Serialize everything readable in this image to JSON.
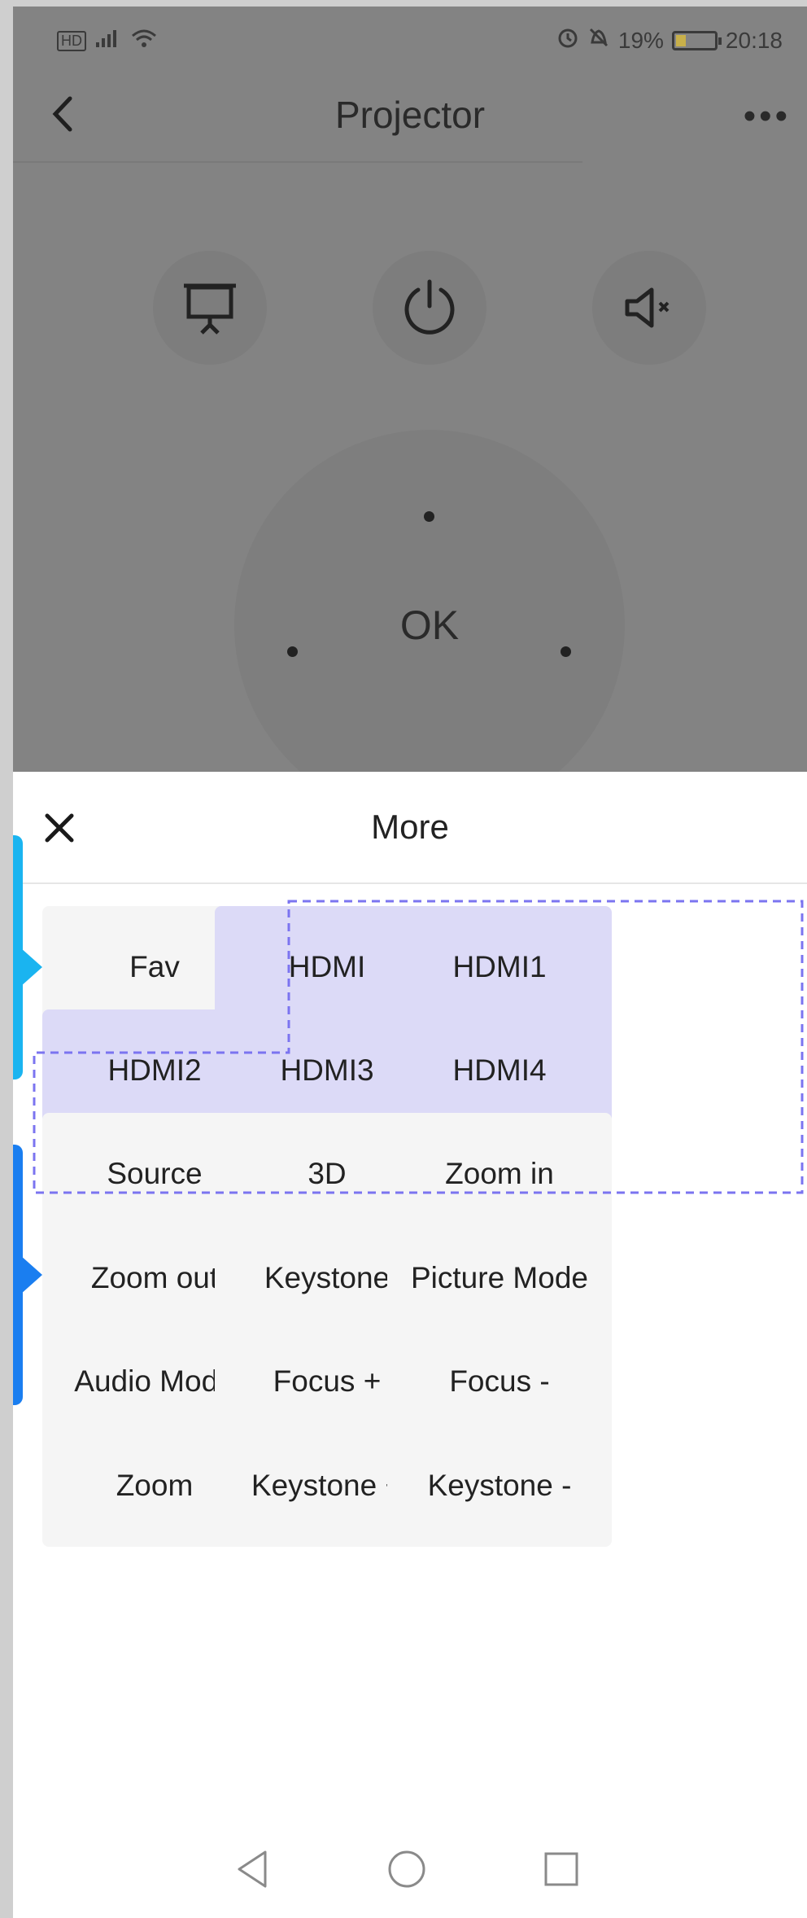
{
  "status_bar": {
    "left_icons": [
      "hd-icon",
      "signal-icon",
      "wifi-icon"
    ],
    "battery_percent": "19%",
    "time": "20:18"
  },
  "header": {
    "title": "Projector"
  },
  "remote": {
    "top_buttons": [
      "presentation-icon",
      "power-icon",
      "mute-icon"
    ],
    "ok_label": "OK"
  },
  "sheet": {
    "title": "More",
    "buttons": [
      "Fav",
      "HDMI",
      "HDMI1",
      "HDMI2",
      "HDMI3",
      "HDMI4",
      "Source",
      "3D",
      "Zoom in",
      "Zoom out",
      "Keystone",
      "Picture Mode",
      "Audio Mode",
      "Focus +",
      "Focus -",
      "Zoom",
      "Keystone +",
      "Keystone -"
    ],
    "highlighted": [
      "HDMI",
      "HDMI1",
      "HDMI2",
      "HDMI3",
      "HDMI4"
    ]
  },
  "colors": {
    "overlay": "#838383",
    "highlight_fill": "#dcdaf7",
    "highlight_border": "#7b74f0",
    "marker_cyan": "#1ab4f0",
    "marker_blue": "#1a7ef0"
  }
}
